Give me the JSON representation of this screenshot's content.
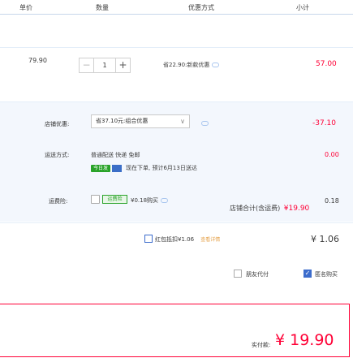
{
  "header": {
    "unit_price": "单价",
    "quantity": "数量",
    "promotion": "优惠方式",
    "subtotal": "小计"
  },
  "item": {
    "price": "79.90",
    "qty_minus": "−",
    "qty_value": "1",
    "qty_plus": "+",
    "promo": "省22.90:新款优惠",
    "subtotal": "57.00"
  },
  "shop": {
    "coupon_label": "店铺优惠:",
    "coupon_value": "省37.10元:组合优惠",
    "discount": "-37.10",
    "shipping_label": "运送方式:",
    "shipping_method": "普通配送 快递 免邮",
    "shipping_tag": "今日发",
    "shipping_note": "现在下单, 预计6月13日送达",
    "shipping_fee": "0.00",
    "insurance_label": "运费险:",
    "insurance_logo": "运费险",
    "insurance_text": "¥0.18购买",
    "insurance_fee": "0.18",
    "total_label": "店铺合计(含运费)",
    "total_value": "¥19.90"
  },
  "red_packet": {
    "text": "红包抵扣¥1.06",
    "link": "查看详情",
    "value": "¥ 1.06"
  },
  "options": {
    "friend_pay": "朋友代付",
    "anonymous": "匿名购买",
    "anonymous_checked": "✓"
  },
  "pay": {
    "label": "实付款:",
    "amount": "¥ 19.90"
  },
  "colors": {
    "accent_red": "#ff0036",
    "accent_blue": "#3c6ccc",
    "section_bg": "#f3f7fd"
  }
}
